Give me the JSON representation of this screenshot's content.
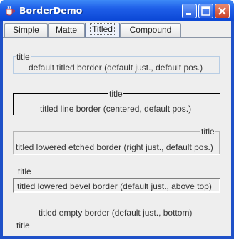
{
  "window": {
    "title": "BorderDemo"
  },
  "tabs": [
    {
      "label": "Simple",
      "selected": false
    },
    {
      "label": "Matte",
      "selected": false
    },
    {
      "label": "Titled",
      "selected": true
    },
    {
      "label": "Compound",
      "selected": false
    }
  ],
  "borders": [
    {
      "title": "title",
      "caption": "default titled border (default just., default pos.)"
    },
    {
      "title": "title",
      "caption": "titled line border (centered, default pos.)"
    },
    {
      "title": "title",
      "caption": "titled lowered etched border (right just., default pos.)"
    },
    {
      "title": "title",
      "caption": "titled lowered bevel border (default just., above top)"
    },
    {
      "title": "title",
      "caption": "titled empty border (default just., bottom)"
    }
  ],
  "colors": {
    "titlebar": "#0a46d4",
    "panel": "#eeeeee",
    "line_border": "#000000",
    "etched_border": "#b5b5b5"
  }
}
